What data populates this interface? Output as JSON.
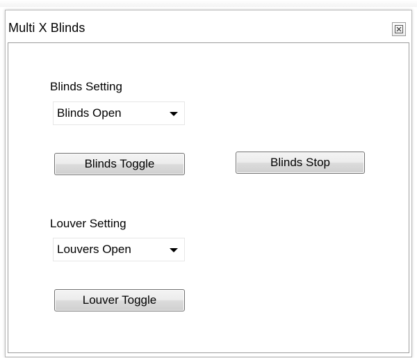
{
  "window": {
    "title": "Multi X Blinds",
    "close_icon": "close-icon"
  },
  "blinds": {
    "label": "Blinds Setting",
    "selected": "Blinds Open",
    "toggle_label": "Blinds Toggle",
    "stop_label": "Blinds Stop"
  },
  "louver": {
    "label": "Louver Setting",
    "selected": "Louvers Open",
    "toggle_label": "Louver Toggle"
  }
}
